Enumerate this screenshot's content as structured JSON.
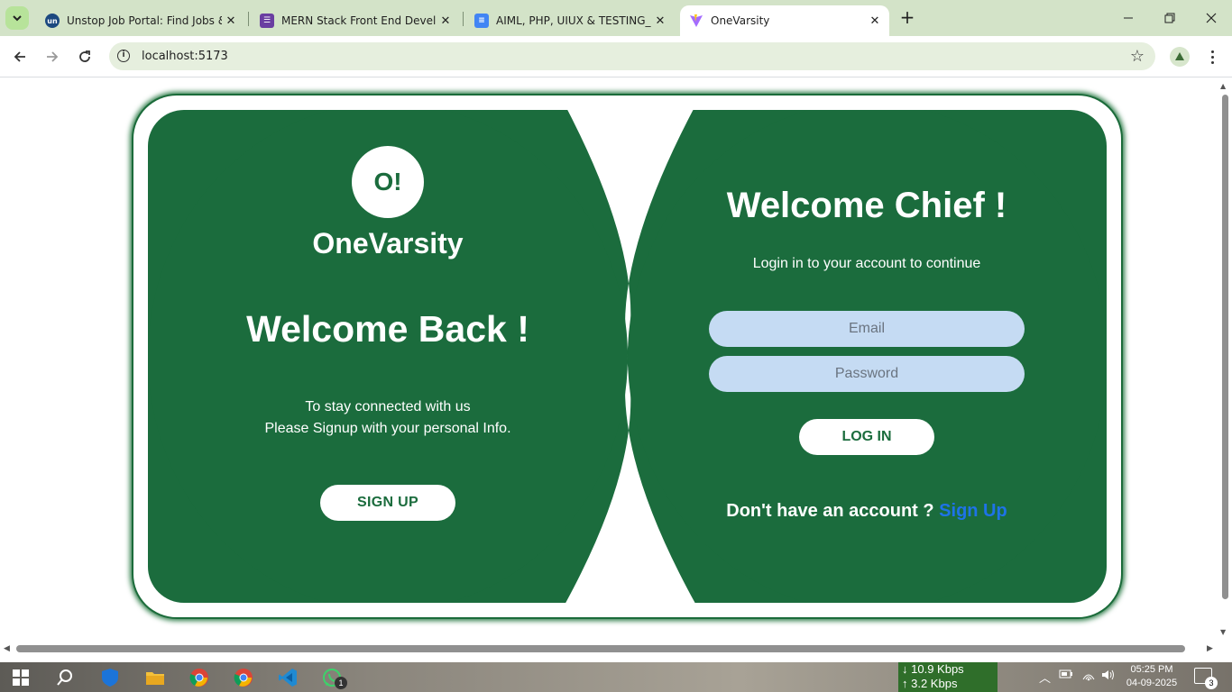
{
  "browser": {
    "tabs": [
      {
        "title": "Unstop Job Portal: Find Jobs &",
        "favicon": "unstop-icon",
        "active": false
      },
      {
        "title": "MERN Stack Front End Develop",
        "favicon": "forms-icon",
        "active": false
      },
      {
        "title": "AIML, PHP, UIUX & TESTING_In",
        "favicon": "docs-icon",
        "active": false
      },
      {
        "title": "OneVarsity",
        "favicon": "vite-icon",
        "active": true
      }
    ],
    "address": "localhost:5173"
  },
  "app": {
    "logo_text": "O!",
    "brand": "OneVarsity",
    "left_heading": "Welcome Back !",
    "left_line1": "To stay connected with us",
    "left_line2": "Please Signup with your personal Info.",
    "signup_button": "SIGN UP",
    "right_heading": "Welcome Chief !",
    "right_subtitle": "Login in to your account to continue",
    "email_placeholder": "Email",
    "password_placeholder": "Password",
    "login_button": "LOG IN",
    "no_account_text": "Don't have an account ?",
    "signup_link": "Sign Up"
  },
  "taskbar": {
    "download_speed": "10.9 Kbps",
    "upload_speed": "3.2 Kbps",
    "time": "05:25 PM",
    "date": "04-09-2025",
    "whatsapp_badge": "1",
    "notification_count": "3"
  },
  "colors": {
    "panel_green": "#1b6c3d",
    "input_blue": "#c5dbf3",
    "link_blue": "#1e73e8"
  }
}
